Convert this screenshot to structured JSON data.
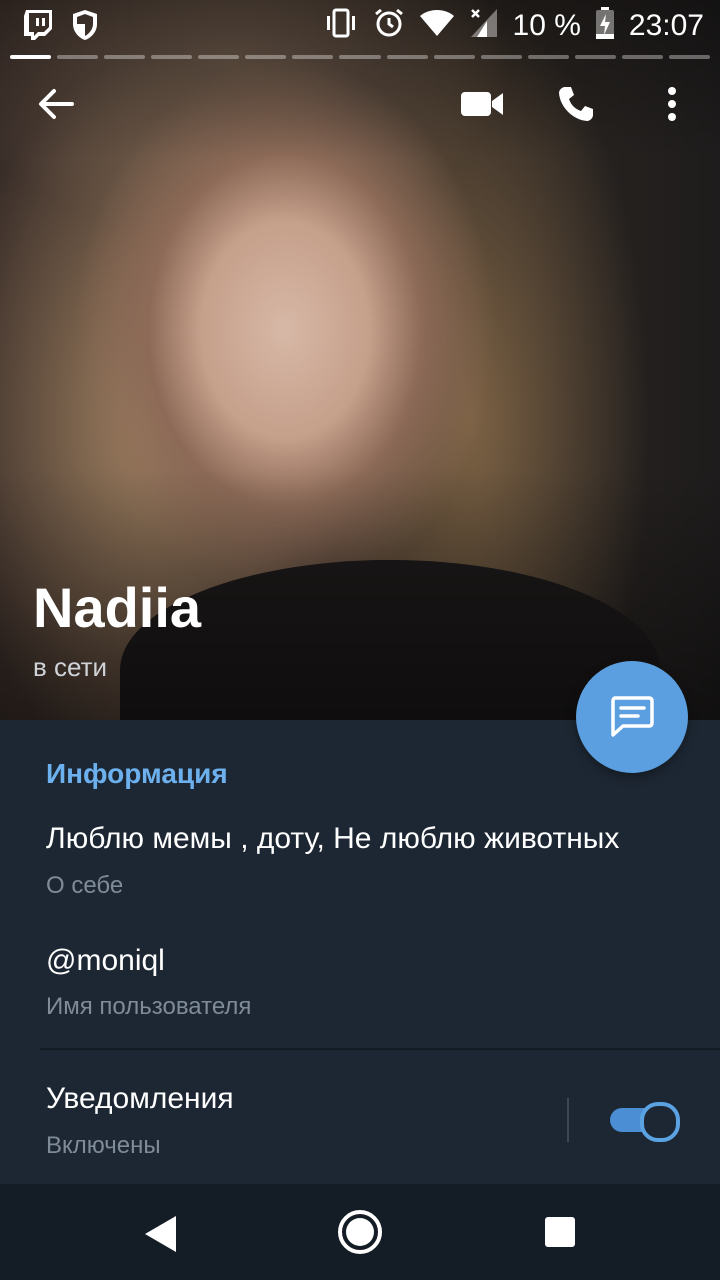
{
  "status_bar": {
    "battery_text": "10 %",
    "time": "23:07",
    "left_icons": [
      "twitch-icon",
      "shield-icon"
    ],
    "right_icons": [
      "vibrate-icon",
      "alarm-icon",
      "wifi-icon",
      "signal-icon",
      "battery-charging-icon"
    ]
  },
  "story_progress": {
    "segments": 15,
    "active": 1
  },
  "topbar": {
    "icons": [
      "back-arrow-icon",
      "video-call-icon",
      "phone-icon",
      "more-vert-icon"
    ]
  },
  "profile": {
    "name": "Nadiia",
    "status": "в сети"
  },
  "fab": {
    "icon": "message-icon",
    "color": "#5b9fe0"
  },
  "info": {
    "section_title": "Информация",
    "bio_value": "Люблю мемы , доту, Не люблю животных",
    "bio_label": "О себе",
    "username_value": "@moniql",
    "username_label": "Имя пользователя",
    "notifications_value": "Уведомления",
    "notifications_label": "Включены",
    "notifications_enabled": true
  },
  "colors": {
    "background": "#1d2733",
    "accent": "#6cb0ed",
    "secondary_text": "#7f8b98",
    "navbar": "#141c26"
  },
  "navbar": {
    "icons": [
      "nav-back-icon",
      "nav-home-icon",
      "nav-recents-icon"
    ]
  }
}
